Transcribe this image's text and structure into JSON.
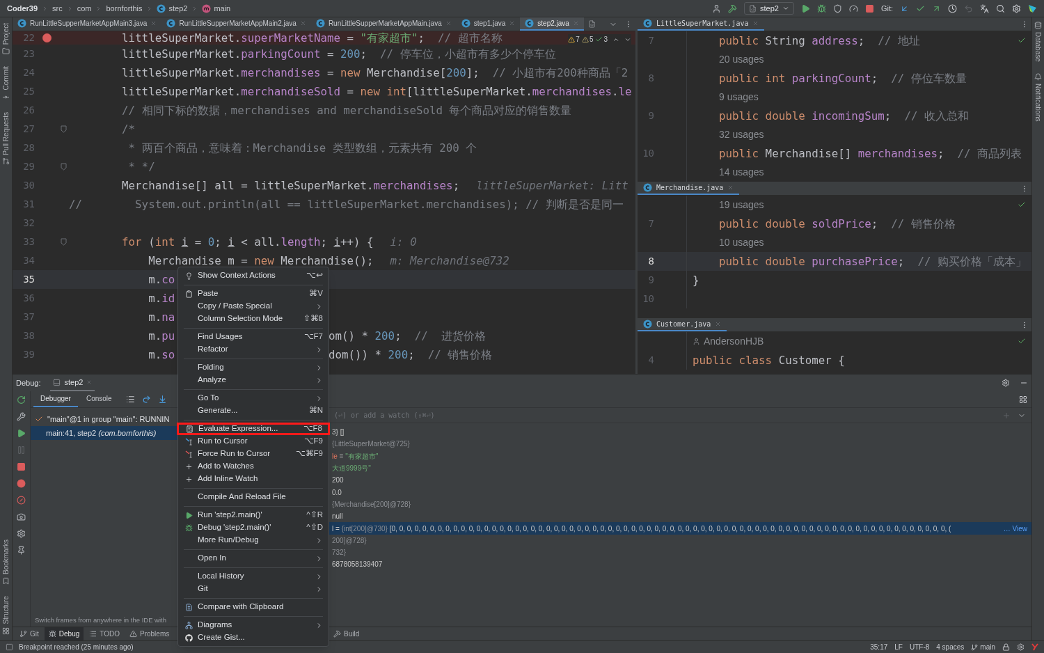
{
  "breadcrumbs": [
    {
      "text": "Coder39",
      "kind": "project"
    },
    {
      "text": "src",
      "kind": "folder"
    },
    {
      "text": "com",
      "kind": "folder"
    },
    {
      "text": "bornforthis",
      "kind": "folder"
    },
    {
      "text": "step2",
      "kind": "class"
    },
    {
      "text": "main",
      "kind": "method"
    }
  ],
  "toolbar": {
    "run_config": "step2",
    "git_label": "Git:"
  },
  "left_stripe": [
    {
      "label": "Project",
      "kind": "project"
    },
    {
      "label": "Commit",
      "kind": "commit"
    },
    {
      "label": "Pull Requests",
      "kind": "pull"
    }
  ],
  "left_stripe_bottom": [
    {
      "label": "Bookmarks",
      "kind": "bookmarks"
    },
    {
      "label": "Structure",
      "kind": "structure"
    }
  ],
  "right_stripe": [
    {
      "label": "Database",
      "kind": "database"
    },
    {
      "label": "Notifications",
      "kind": "notifications"
    }
  ],
  "editor": {
    "tabs": [
      {
        "label": "RunLittleSupperMarketAppMain3.java",
        "selected": false
      },
      {
        "label": "RunLittleSupperMarketAppMain2.java",
        "selected": false
      },
      {
        "label": "RunLittleSupperMarketAppMain.java",
        "selected": false
      },
      {
        "label": "step1.java",
        "selected": false
      },
      {
        "label": "step2.java",
        "selected": true
      }
    ],
    "inspections": [
      {
        "kind": "warning",
        "count": "7"
      },
      {
        "kind": "weak_warning",
        "count": "5"
      },
      {
        "kind": "ok",
        "count": "3"
      }
    ],
    "lines": [
      {
        "n": "22",
        "bp": true,
        "cur": false,
        "fold": false,
        "t": [
          {
            "kind": "txt",
            "text": "        littleSuperMarket."
          },
          {
            "kind": "fld",
            "text": "superMarketName"
          },
          {
            "kind": "txt",
            "text": " = "
          },
          {
            "kind": "str",
            "text": "\"有家超市\""
          },
          {
            "kind": "txt",
            "text": ";  "
          },
          {
            "kind": "cmt",
            "text": "// 超市名称"
          }
        ]
      },
      {
        "n": "23",
        "bp": false,
        "cur": false,
        "fold": false,
        "t": [
          {
            "kind": "txt",
            "text": "        littleSuperMarket."
          },
          {
            "kind": "fld",
            "text": "parkingCount"
          },
          {
            "kind": "txt",
            "text": " = "
          },
          {
            "kind": "num",
            "text": "200"
          },
          {
            "kind": "txt",
            "text": ";  "
          },
          {
            "kind": "cmt",
            "text": "// 停车位，小超市有多少个停车位"
          }
        ]
      },
      {
        "n": "24",
        "bp": false,
        "cur": false,
        "fold": false,
        "t": [
          {
            "kind": "txt",
            "text": "        littleSuperMarket."
          },
          {
            "kind": "fld",
            "text": "merchandises"
          },
          {
            "kind": "txt",
            "text": " = "
          },
          {
            "kind": "kw",
            "text": "new"
          },
          {
            "kind": "txt",
            "text": " Merchandise["
          },
          {
            "kind": "num",
            "text": "200"
          },
          {
            "kind": "txt",
            "text": "];  "
          },
          {
            "kind": "cmt",
            "text": "// 小超市有200种商品「2"
          }
        ]
      },
      {
        "n": "25",
        "bp": false,
        "cur": false,
        "fold": false,
        "t": [
          {
            "kind": "txt",
            "text": "        littleSuperMarket."
          },
          {
            "kind": "fld",
            "text": "merchandiseSold"
          },
          {
            "kind": "txt",
            "text": " = "
          },
          {
            "kind": "kw",
            "text": "new int"
          },
          {
            "kind": "txt",
            "text": "[littleSuperMarket."
          },
          {
            "kind": "fld",
            "text": "merchandises"
          },
          {
            "kind": "txt",
            "text": "."
          },
          {
            "kind": "fld",
            "text": "le"
          }
        ]
      },
      {
        "n": "26",
        "bp": false,
        "cur": false,
        "fold": false,
        "t": [
          {
            "kind": "cmt",
            "text": "        // 相同下标的数据，merchandises and merchandiseSold 每个商品对应的销售数量"
          }
        ]
      },
      {
        "n": "27",
        "bp": false,
        "cur": false,
        "fold": true,
        "t": [
          {
            "kind": "cmt",
            "text": "        /*"
          }
        ]
      },
      {
        "n": "28",
        "bp": false,
        "cur": false,
        "fold": false,
        "t": [
          {
            "kind": "cmt",
            "text": "         * 两百个商品，意味着：Merchandise 类型数组，元素共有 200 个"
          }
        ]
      },
      {
        "n": "29",
        "bp": false,
        "cur": false,
        "fold": true,
        "t": [
          {
            "kind": "cmt",
            "text": "         * */"
          }
        ]
      },
      {
        "n": "30",
        "bp": false,
        "cur": false,
        "fold": false,
        "t": [
          {
            "kind": "txt",
            "text": "        Merchandise[] all = littleSuperMarket."
          },
          {
            "kind": "fld",
            "text": "merchandises"
          },
          {
            "kind": "txt",
            "text": ";"
          }
        ],
        "hint": "littleSuperMarket: Litt"
      },
      {
        "n": "31",
        "bp": false,
        "cur": false,
        "fold": false,
        "t": [
          {
            "kind": "cmt",
            "text": "//        System.out.println(all == littleSuperMarket.merchandises); // 判断是否是同一"
          }
        ]
      },
      {
        "n": "32",
        "bp": false,
        "cur": false,
        "fold": false
      },
      {
        "n": "33",
        "bp": false,
        "cur": false,
        "fold": true,
        "t": [
          {
            "kind": "kw",
            "text": "        for"
          },
          {
            "kind": "txt",
            "text": " ("
          },
          {
            "kind": "kw",
            "text": "int "
          },
          {
            "kind": "uvar",
            "text": "i"
          },
          {
            "kind": "txt",
            "text": " = "
          },
          {
            "kind": "num",
            "text": "0"
          },
          {
            "kind": "txt",
            "text": "; "
          },
          {
            "kind": "uvar",
            "text": "i"
          },
          {
            "kind": "txt",
            "text": " < all."
          },
          {
            "kind": "fld",
            "text": "length"
          },
          {
            "kind": "txt",
            "text": "; "
          },
          {
            "kind": "uvar",
            "text": "i"
          },
          {
            "kind": "txt",
            "text": "++) {"
          }
        ],
        "hint": "i: 0"
      },
      {
        "n": "34",
        "bp": false,
        "cur": false,
        "fold": false,
        "t": [
          {
            "kind": "txt",
            "text": "            Merchandise m = "
          },
          {
            "kind": "kw",
            "text": "new"
          },
          {
            "kind": "txt",
            "text": " Merchandise();"
          }
        ],
        "hint": "m: Merchandise@732"
      },
      {
        "n": "35",
        "bp": false,
        "cur": true,
        "fold": false,
        "t": [
          {
            "kind": "txt",
            "text": "            m."
          },
          {
            "kind": "fld",
            "text": "co"
          }
        ]
      },
      {
        "n": "36",
        "bp": false,
        "cur": false,
        "fold": false,
        "t": [
          {
            "kind": "txt",
            "text": "            m."
          },
          {
            "kind": "fld",
            "text": "id"
          }
        ]
      },
      {
        "n": "37",
        "bp": false,
        "cur": false,
        "fold": false,
        "t": [
          {
            "kind": "txt",
            "text": "            m."
          },
          {
            "kind": "fld",
            "text": "na"
          }
        ]
      },
      {
        "n": "38",
        "bp": false,
        "cur": false,
        "fold": false,
        "t": [
          {
            "kind": "txt",
            "text": "            m."
          },
          {
            "kind": "fld",
            "text": "pu"
          }
        ],
        "tail": [
          {
            "kind": "txt",
            "text": "om() * "
          },
          {
            "kind": "num",
            "text": "200"
          },
          {
            "kind": "txt",
            "text": ";  "
          },
          {
            "kind": "cmt",
            "text": "//  进货价格"
          }
        ]
      },
      {
        "n": "39",
        "bp": false,
        "cur": false,
        "fold": false,
        "t": [
          {
            "kind": "txt",
            "text": "            m."
          },
          {
            "kind": "fld",
            "text": "so"
          }
        ],
        "tail": [
          {
            "kind": "txt",
            "text": "dom()) * "
          },
          {
            "kind": "num",
            "text": "200"
          },
          {
            "kind": "txt",
            "text": ";  "
          },
          {
            "kind": "cmt",
            "text": "// 销售价格"
          }
        ]
      }
    ]
  },
  "split_editors": [
    {
      "tab": "LittleSuperMarket.java",
      "rows": [
        {
          "kind": "code",
          "n": "7",
          "cur": false,
          "t": [
            {
              "kind": "kw",
              "text": "    public"
            },
            {
              "kind": "txt",
              "text": " String "
            },
            {
              "kind": "fld",
              "text": "address"
            },
            {
              "kind": "txt",
              "text": ";  "
            },
            {
              "kind": "cmt",
              "text": "// 地址"
            }
          ]
        },
        {
          "kind": "usages",
          "text": "20 usages"
        },
        {
          "kind": "code",
          "n": "8",
          "cur": false,
          "t": [
            {
              "kind": "kw",
              "text": "    public int "
            },
            {
              "kind": "fld",
              "text": "parkingCount"
            },
            {
              "kind": "txt",
              "text": ";  "
            },
            {
              "kind": "cmt",
              "text": "// 停位车数量"
            }
          ]
        },
        {
          "kind": "usages",
          "text": "9 usages"
        },
        {
          "kind": "code",
          "n": "9",
          "cur": false,
          "t": [
            {
              "kind": "kw",
              "text": "    public double "
            },
            {
              "kind": "fld",
              "text": "incomingSum"
            },
            {
              "kind": "txt",
              "text": ";  "
            },
            {
              "kind": "cmt",
              "text": "// 收入总和"
            }
          ]
        },
        {
          "kind": "usages",
          "text": "32 usages"
        },
        {
          "kind": "code",
          "n": "10",
          "cur": false,
          "t": [
            {
              "kind": "kw",
              "text": "    public"
            },
            {
              "kind": "txt",
              "text": " Merchandise[] "
            },
            {
              "kind": "fld",
              "text": "merchandises"
            },
            {
              "kind": "txt",
              "text": ";  "
            },
            {
              "kind": "cmt",
              "text": "// 商品列表"
            }
          ]
        },
        {
          "kind": "usages",
          "text": "14 usages"
        }
      ]
    },
    {
      "tab": "Merchandise.java",
      "rows": [
        {
          "kind": "usages",
          "text": "19 usages"
        },
        {
          "kind": "code",
          "n": "7",
          "cur": false,
          "t": [
            {
              "kind": "kw",
              "text": "    public double "
            },
            {
              "kind": "fld",
              "text": "soldPrice"
            },
            {
              "kind": "txt",
              "text": ";  "
            },
            {
              "kind": "cmt",
              "text": "// 销售价格"
            }
          ]
        },
        {
          "kind": "usages",
          "text": "10 usages"
        },
        {
          "kind": "code",
          "n": "8",
          "cur": true,
          "t": [
            {
              "kind": "kw",
              "text": "    public double "
            },
            {
              "kind": "fld",
              "text": "purchasePrice"
            },
            {
              "kind": "txt",
              "text": ";  "
            },
            {
              "kind": "cmt",
              "text": "// 购买价格「成本」"
            }
          ]
        },
        {
          "kind": "code",
          "n": "9",
          "cur": false,
          "t": [
            {
              "kind": "txt",
              "text": "}"
            }
          ]
        },
        {
          "kind": "code",
          "n": "10",
          "cur": false
        }
      ]
    },
    {
      "tab": "Customer.java",
      "rows": [
        {
          "kind": "author",
          "text": "AndersonHJB"
        },
        {
          "kind": "code",
          "n": "4",
          "cur": false,
          "t": [
            {
              "kind": "kw",
              "text": "public class"
            },
            {
              "kind": "txt",
              "text": " Customer {"
            }
          ]
        }
      ]
    }
  ],
  "debug": {
    "label": "Debug:",
    "session_tab": "step2",
    "tabs": [
      {
        "label": "Debugger",
        "selected": true
      },
      {
        "label": "Console",
        "selected": false
      }
    ],
    "frames": [
      {
        "kind": "thread",
        "text": "\"main\"@1 in group \"main\": RUNNIN",
        "selected": false
      },
      {
        "kind": "frame",
        "text": "main:41, step2 *(com.bornforthis)*",
        "selected": true
      }
    ],
    "frames_hint": "Switch frames from anywhere in the IDE with",
    "watch_placeholder": "(⏎) or add a watch (⇧⌘⏎)",
    "variables": [
      {
        "selected": false,
        "p": [
          {
            "kind": "val",
            "text": "3} []"
          }
        ]
      },
      {
        "selected": false,
        "p": [
          {
            "kind": "ref",
            "text": "{LittleSuperMarket@725}"
          }
        ]
      },
      {
        "selected": false,
        "p": [
          {
            "kind": "name",
            "text": "le"
          },
          {
            "kind": "val",
            "text": " = "
          },
          {
            "kind": "str",
            "text": "\"有家超市\""
          }
        ]
      },
      {
        "selected": false,
        "p": [
          {
            "kind": "str",
            "text": "大道9999号\""
          }
        ]
      },
      {
        "selected": false,
        "p": [
          {
            "kind": "val",
            "text": "200"
          }
        ]
      },
      {
        "selected": false,
        "p": [
          {
            "kind": "val",
            "text": "0.0"
          }
        ]
      },
      {
        "selected": false,
        "p": [
          {
            "kind": "ref",
            "text": "{Merchandise[200]@728}"
          }
        ]
      },
      {
        "selected": false,
        "p": [
          {
            "kind": "val",
            "text": "null"
          }
        ]
      },
      {
        "selected": true,
        "p": [
          {
            "kind": "val",
            "text": "l = "
          },
          {
            "kind": "ref",
            "text": "{int[200]@730} "
          },
          {
            "kind": "val",
            "text": "[0, 0, 0, 0, 0, 0, 0, 0, 0, 0, 0, 0, 0, 0, 0, 0, 0, 0, 0, 0, 0, 0, 0, 0, 0, 0, 0, 0, 0, 0, 0, 0, 0, 0, 0, 0, 0, 0, 0, 0, 0, 0, 0, 0, 0, 0, 0, 0, 0, 0, 0, 0, 0, 0, 0, 0, 0, 0, 0, 0, 0, 0, 0, 0, 0, 0, 0, 0, 0, 0, 0, 0, ("
          }
        ],
        "link": "… View"
      },
      {
        "selected": false,
        "p": [
          {
            "kind": "ref",
            "text": "200]@728}"
          }
        ]
      },
      {
        "selected": false,
        "p": [
          {
            "kind": "ref",
            "text": "732}"
          }
        ]
      },
      {
        "selected": false,
        "p": [
          {
            "kind": "val",
            "text": "6878058139407"
          }
        ]
      }
    ]
  },
  "context_menu": [
    [
      {
        "kind": "bulb",
        "label": "Show Context Actions",
        "shortcut": "⌥↩",
        "submenu": false,
        "boxed": false
      }
    ],
    [
      {
        "kind": "paste",
        "label": "Paste",
        "shortcut": "⌘V",
        "submenu": false,
        "boxed": false
      },
      {
        "kind": "plain",
        "label": "Copy / Paste Special",
        "submenu": true,
        "boxed": false
      },
      {
        "kind": "plain",
        "label": "Column Selection Mode",
        "shortcut": "⇧⌘8",
        "submenu": false,
        "boxed": false
      }
    ],
    [
      {
        "kind": "plain",
        "label": "Find Usages",
        "shortcut": "⌥F7",
        "submenu": false,
        "boxed": false
      },
      {
        "kind": "plain",
        "label": "Refactor",
        "submenu": true,
        "boxed": false
      }
    ],
    [
      {
        "kind": "plain",
        "label": "Folding",
        "submenu": true,
        "boxed": false
      },
      {
        "kind": "plain",
        "label": "Analyze",
        "submenu": true,
        "boxed": false
      }
    ],
    [
      {
        "kind": "plain",
        "label": "Go To",
        "submenu": true,
        "boxed": false
      },
      {
        "kind": "plain",
        "label": "Generate...",
        "shortcut": "⌘N",
        "submenu": false,
        "boxed": false
      }
    ],
    [
      {
        "kind": "evaluate",
        "label": "Evaluate Expression...",
        "shortcut": "⌥F8",
        "submenu": false,
        "boxed": true
      },
      {
        "kind": "run_to_cursor",
        "label": "Run to Cursor",
        "shortcut": "⌥F9",
        "submenu": false,
        "boxed": false
      },
      {
        "kind": "force_run",
        "label": "Force Run to Cursor",
        "shortcut": "⌥⌘F9",
        "submenu": false,
        "boxed": false
      },
      {
        "kind": "watch",
        "label": "Add to Watches",
        "submenu": false,
        "boxed": false
      },
      {
        "kind": "watch",
        "label": "Add Inline Watch",
        "submenu": false,
        "boxed": false
      }
    ],
    [
      {
        "kind": "plain",
        "label": "Compile And Reload File",
        "submenu": false,
        "boxed": false
      }
    ],
    [
      {
        "kind": "run",
        "label": "Run 'step2.main()'",
        "shortcut": "^⇧R",
        "submenu": false,
        "boxed": false
      },
      {
        "kind": "debug",
        "label": "Debug 'step2.main()'",
        "shortcut": "^⇧D",
        "submenu": false,
        "boxed": false
      },
      {
        "kind": "plain",
        "label": "More Run/Debug",
        "submenu": true,
        "boxed": false
      }
    ],
    [
      {
        "kind": "plain",
        "label": "Open In",
        "submenu": true,
        "boxed": false
      }
    ],
    [
      {
        "kind": "plain",
        "label": "Local History",
        "submenu": true,
        "boxed": false
      },
      {
        "kind": "plain",
        "label": "Git",
        "submenu": true,
        "boxed": false
      }
    ],
    [
      {
        "kind": "compare",
        "label": "Compare with Clipboard",
        "submenu": false,
        "boxed": false
      }
    ],
    [
      {
        "kind": "diagram",
        "label": "Diagrams",
        "submenu": true,
        "boxed": false
      },
      {
        "kind": "gist",
        "label": "Create Gist...",
        "submenu": false,
        "boxed": false
      }
    ]
  ],
  "tool_windows": [
    {
      "label": "Git",
      "kind": "git",
      "selected": false
    },
    {
      "label": "Debug",
      "kind": "debug",
      "selected": true
    },
    {
      "label": "TODO",
      "kind": "todo",
      "selected": false
    },
    {
      "label": "Problems",
      "kind": "problems",
      "selected": false
    }
  ],
  "tool_windows_2": [
    {
      "label": "Build",
      "kind": "build",
      "selected": false
    }
  ],
  "status": {
    "message": "Breakpoint reached (25 minutes ago)",
    "items": [
      "35:17",
      "LF",
      "UTF-8",
      "4 spaces"
    ],
    "branch": "main"
  }
}
